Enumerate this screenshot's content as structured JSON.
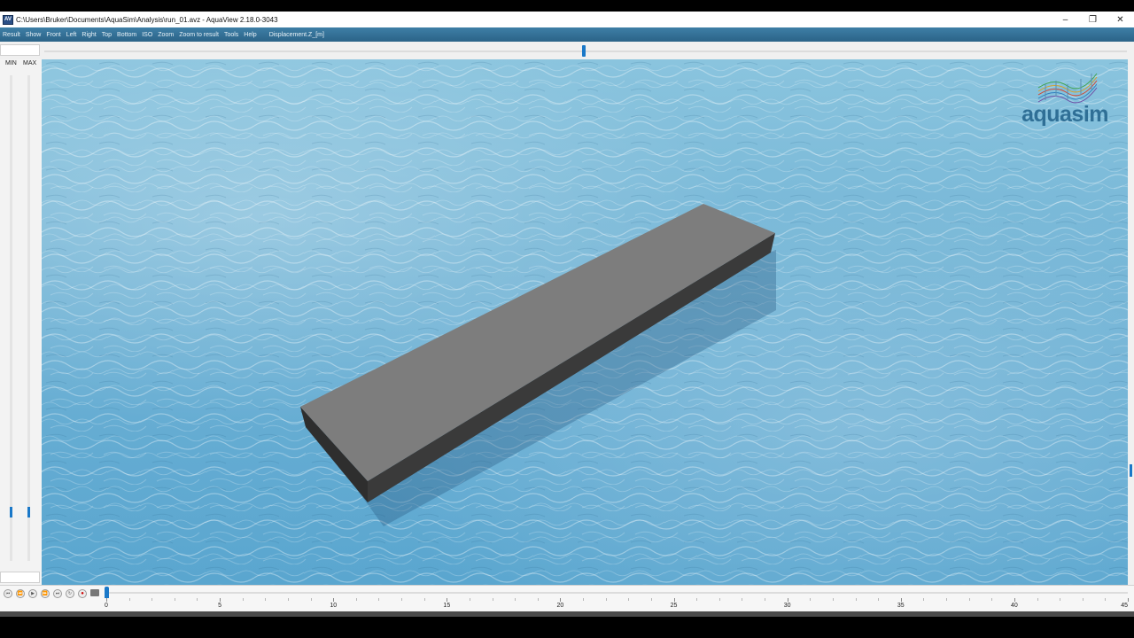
{
  "window": {
    "title": "C:\\Users\\Bruker\\Documents\\AquaSim\\Analysis\\run_01.avz - AquaView 2.18.0-3043",
    "icon_text": "AV",
    "controls": {
      "minimize": "–",
      "restore": "❐",
      "close": "✕"
    }
  },
  "menu": {
    "items": [
      "Result",
      "Show",
      "Front",
      "Left",
      "Right",
      "Top",
      "Bottom",
      "ISO",
      "Zoom",
      "Zoom to result",
      "Tools",
      "Help"
    ],
    "result_type": "Displacement.Z_[m]"
  },
  "left_panel": {
    "min_label": "MIN",
    "max_label": "MAX"
  },
  "logo": {
    "text": "aquasim"
  },
  "timeline": {
    "buttons": [
      "first-frame",
      "previous-frame",
      "play",
      "next-frame",
      "last-frame",
      "loop",
      "record",
      "camera"
    ],
    "current_time": 0,
    "tick_labels": [
      "0",
      "5",
      "10",
      "15",
      "20",
      "25",
      "30",
      "35",
      "40",
      "45"
    ]
  },
  "colors": {
    "accent": "#1a78c8",
    "menubar": "#2b6388",
    "water": "#74b5d6",
    "pontoon_top": "#7d7d7d",
    "pontoon_side": "#3a3a3a",
    "logo_text": "#2f6f96"
  }
}
